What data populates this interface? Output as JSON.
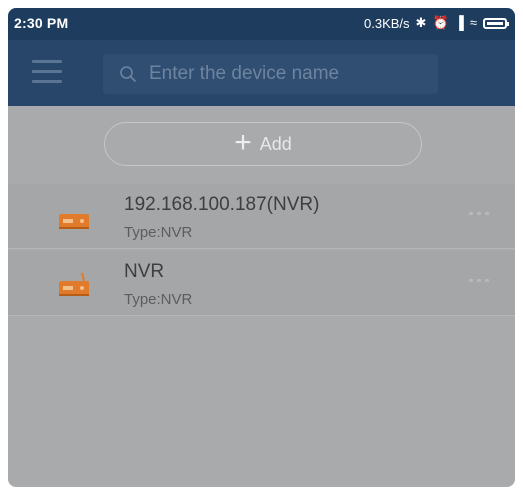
{
  "status_bar": {
    "time": "2:30 PM",
    "network_speed": "0.3KB/s",
    "icons": [
      "bluetooth-icon",
      "alarm-icon",
      "signal-icon",
      "wifi-icon",
      "battery-icon"
    ]
  },
  "header": {
    "menu_icon": "hamburger-menu-icon",
    "search": {
      "placeholder": "Enter the device name",
      "icon": "search-icon"
    }
  },
  "add_button": {
    "icon": "plus-icon",
    "label": "Add"
  },
  "devices": [
    {
      "name": "192.168.100.187(NVR)",
      "type": "Type:NVR",
      "icon": "nvr-device-icon"
    },
    {
      "name": "NVR",
      "type": "Type:NVR",
      "icon": "nvr-device-icon"
    }
  ],
  "colors": {
    "header": "#27466a",
    "status_bar": "#1e3d5e",
    "background": "#a9aaac",
    "device_icon": "#e07b2b"
  }
}
